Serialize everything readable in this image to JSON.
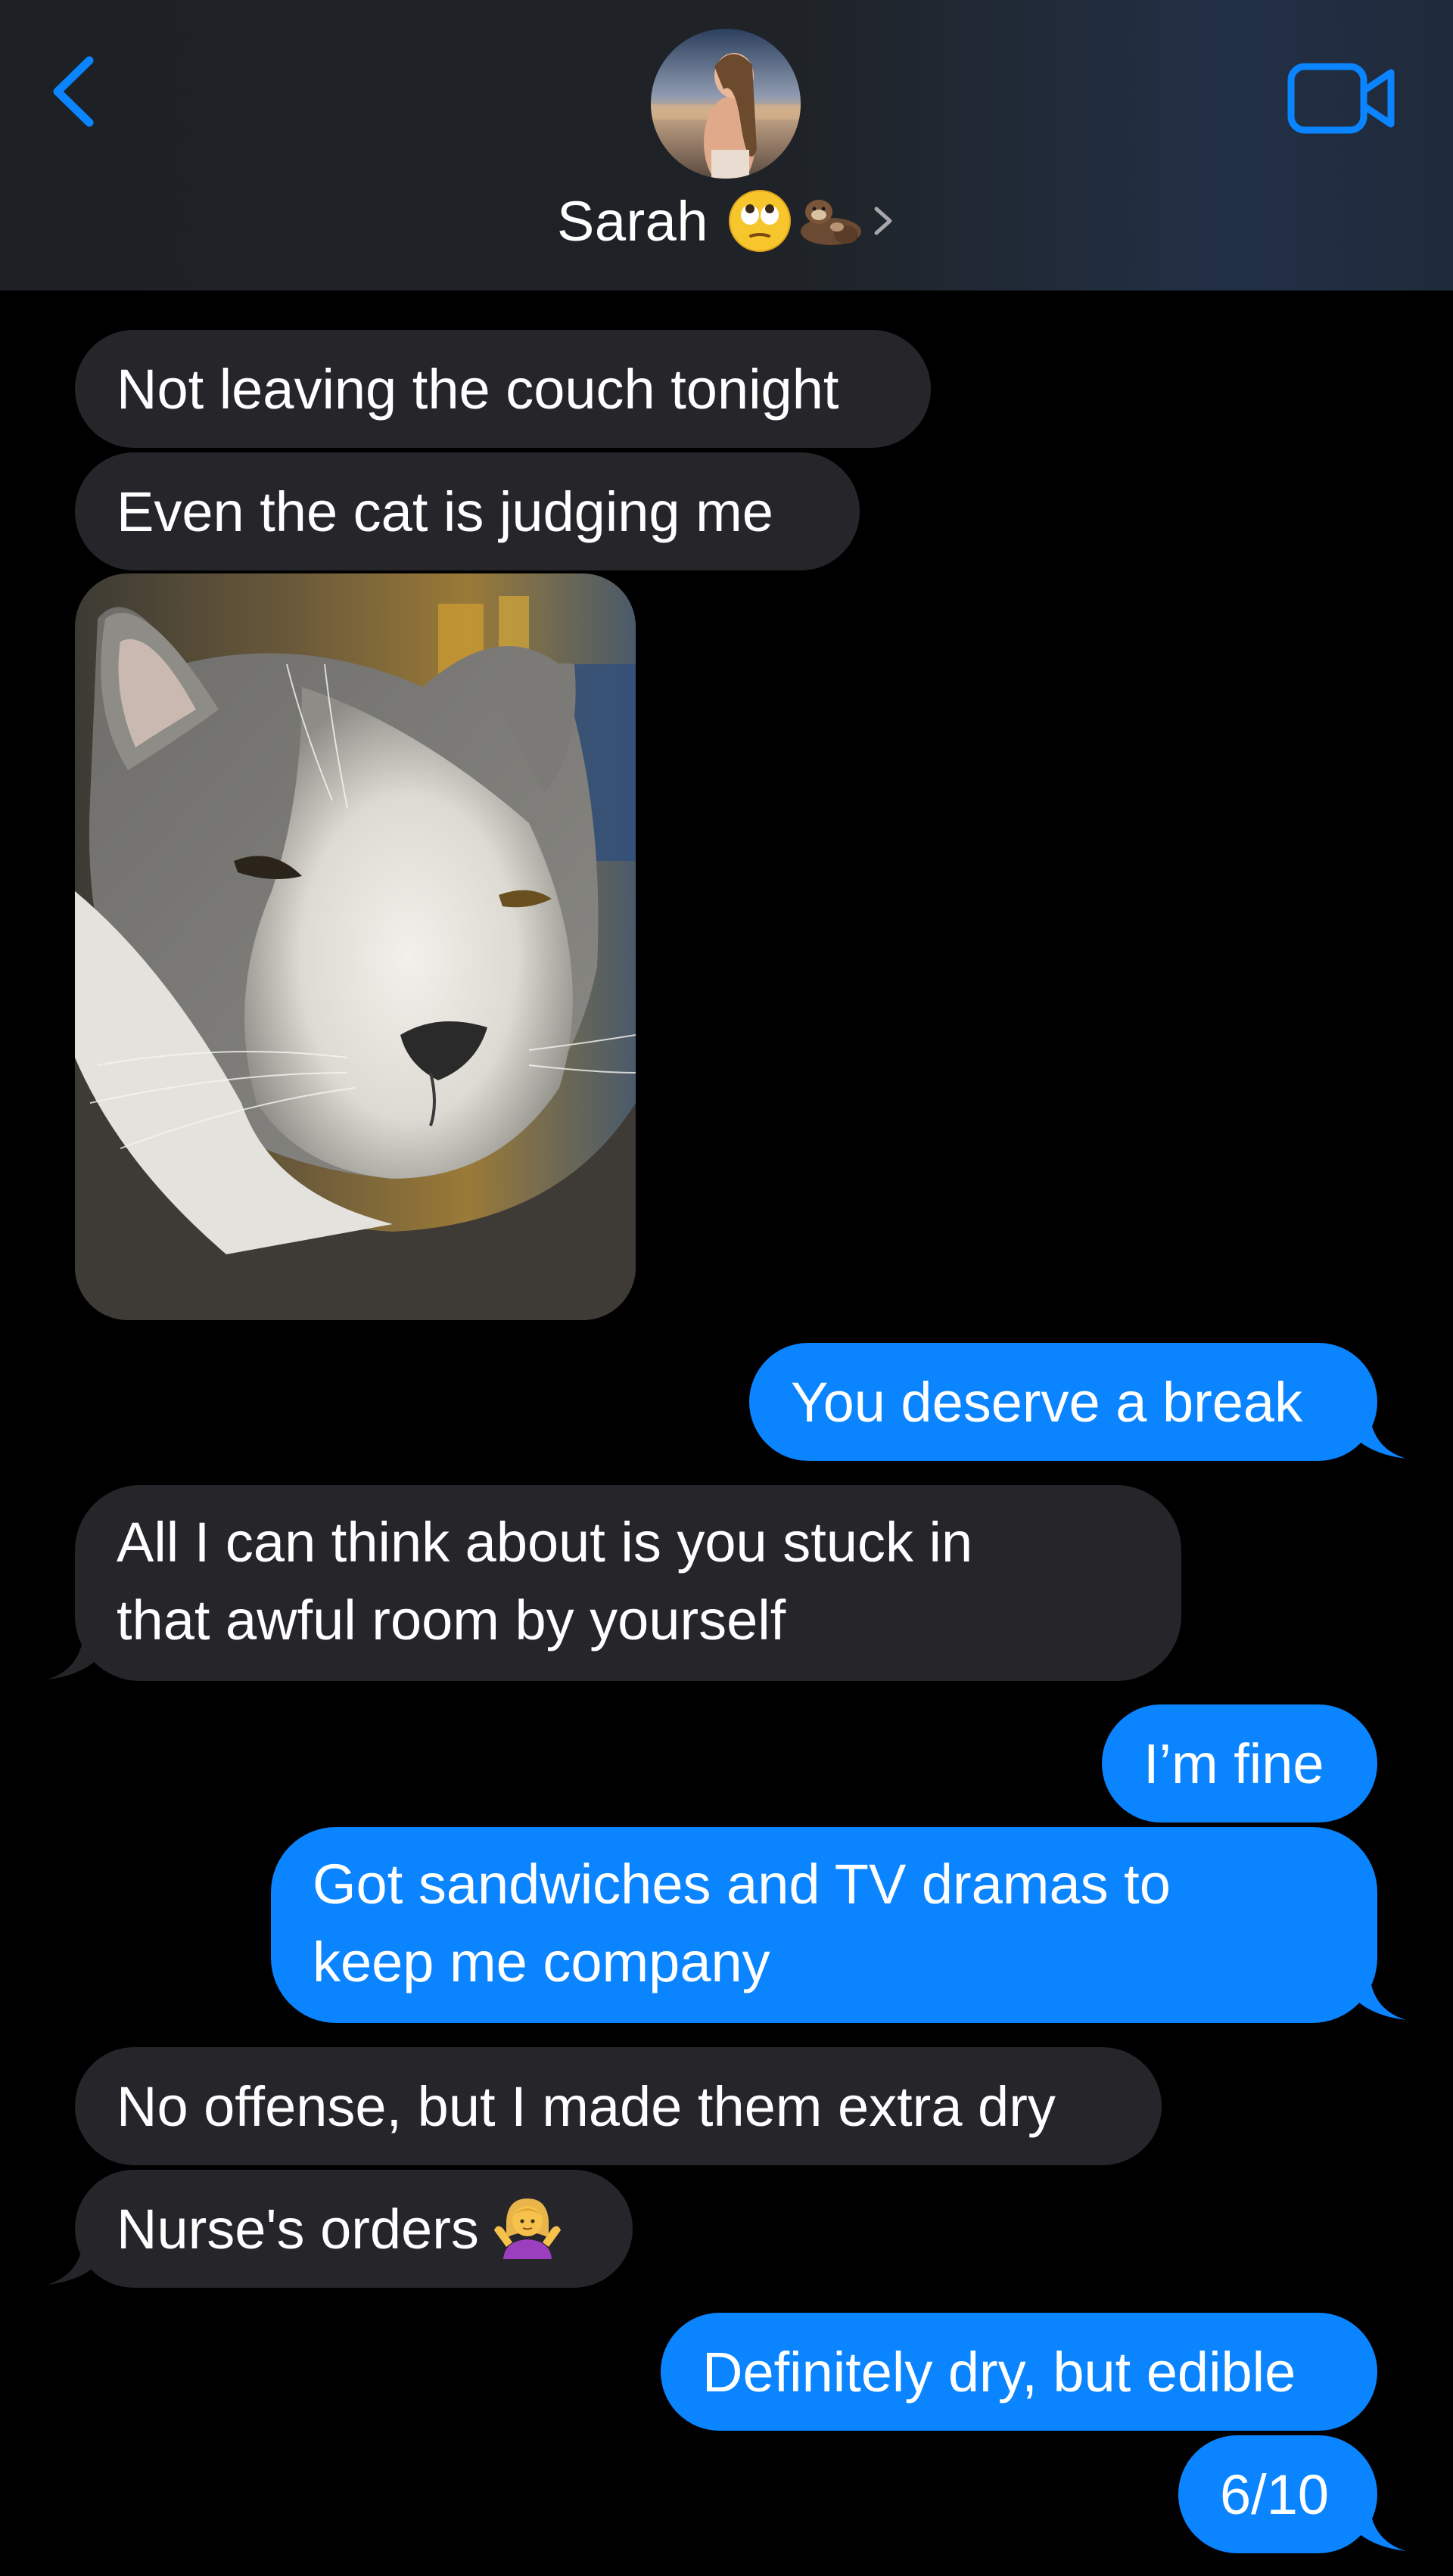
{
  "header": {
    "contact_name": "Sarah",
    "name_emojis": [
      "face-with-rolling-eyes",
      "otters-holding-hands"
    ],
    "back_icon": "chevron-left-icon",
    "video_icon": "video-camera-icon",
    "accent_color": "#0a84ff"
  },
  "messages": [
    {
      "side": "incoming",
      "text": "Not leaving the couch tonight"
    },
    {
      "side": "incoming",
      "text": "Even the cat is judging me"
    },
    {
      "side": "incoming",
      "type": "photo",
      "subject": "cat"
    },
    {
      "side": "outgoing",
      "text": "You deserve a break"
    },
    {
      "side": "incoming",
      "lines": [
        "All I can think about is you stuck in",
        "that awful room by yourself"
      ]
    },
    {
      "side": "outgoing",
      "text": "I’m fine"
    },
    {
      "side": "outgoing",
      "lines": [
        "Got sandwiches and TV dramas to",
        "keep me company"
      ]
    },
    {
      "side": "incoming",
      "text": "No offense, but I made them extra dry"
    },
    {
      "side": "incoming",
      "text": "Nurse's orders",
      "emoji": "woman-shrugging"
    },
    {
      "side": "outgoing",
      "text": "Definitely dry, but edible"
    },
    {
      "side": "outgoing",
      "text": "6/10"
    }
  ],
  "colors": {
    "incoming_bubble": "#26252a",
    "outgoing_bubble": "#0a84ff",
    "background": "#000000"
  }
}
